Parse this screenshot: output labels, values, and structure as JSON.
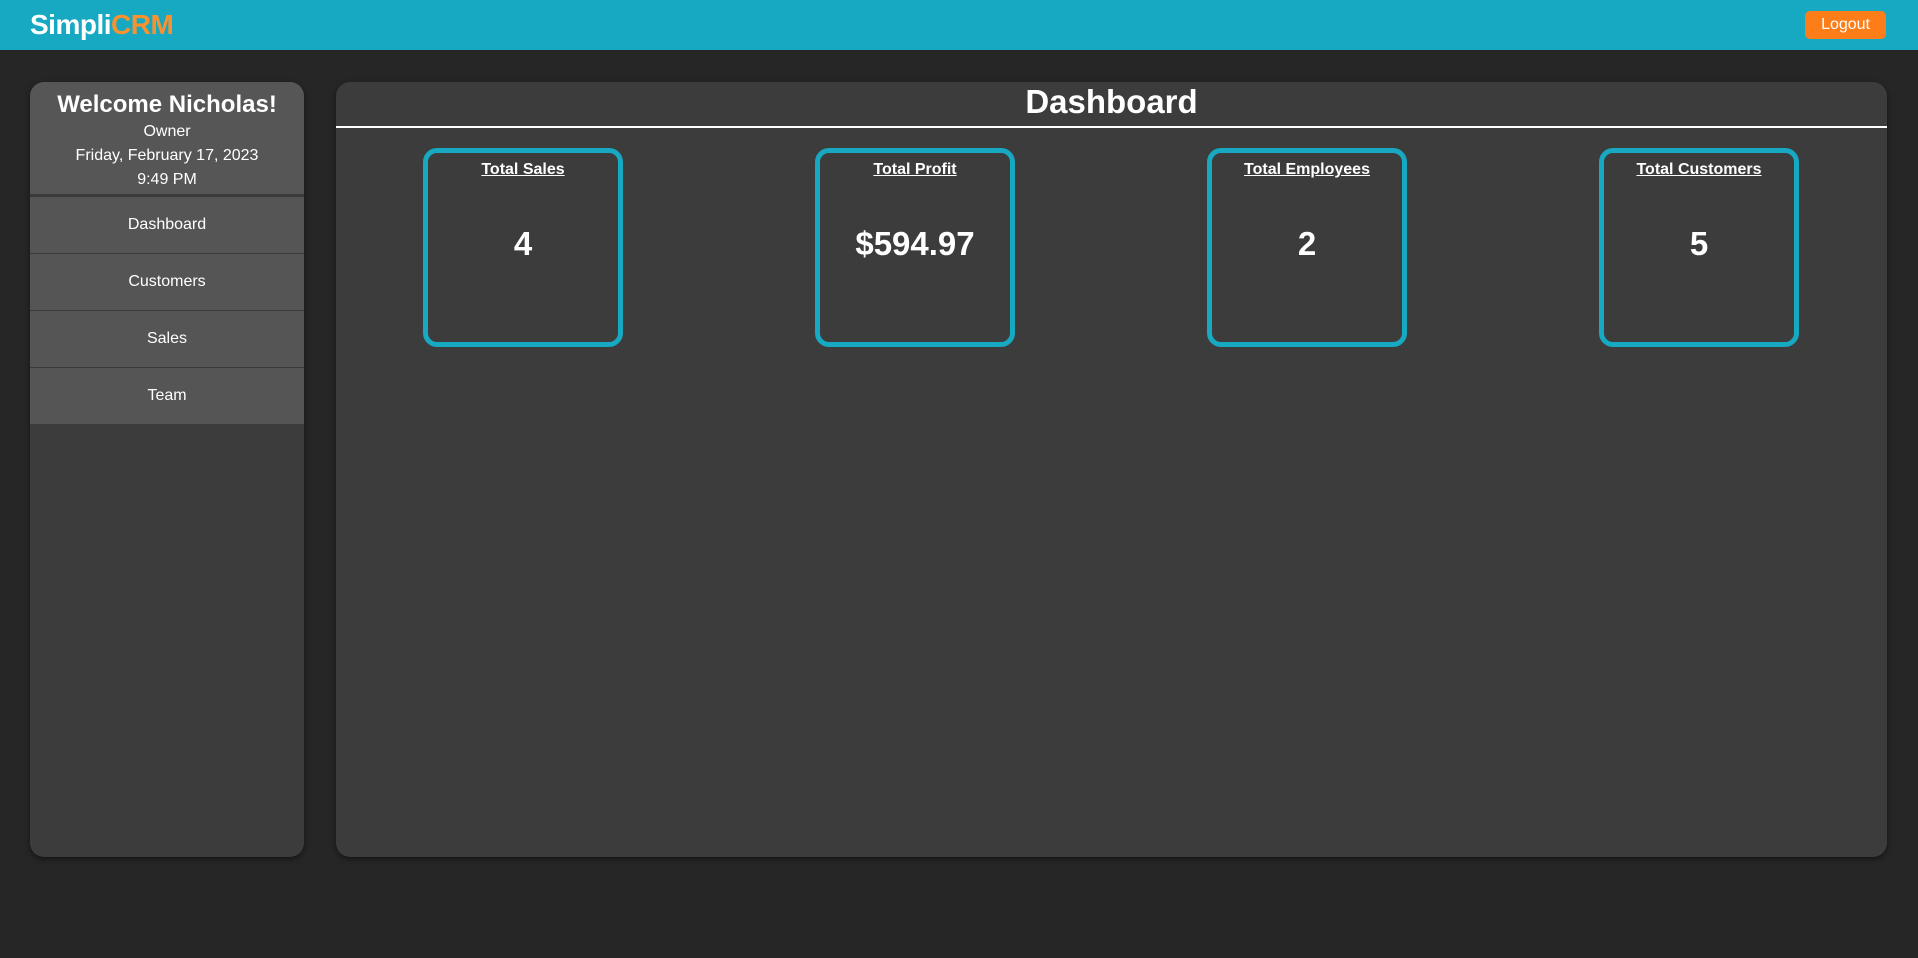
{
  "header": {
    "brand_part1": "Simpli",
    "brand_part2": "CRM",
    "logout_label": "Logout"
  },
  "sidebar": {
    "welcome": "Welcome Nicholas!",
    "role": "Owner",
    "date": "Friday, February 17, 2023",
    "time": "9:49 PM",
    "items": [
      {
        "label": "Dashboard"
      },
      {
        "label": "Customers"
      },
      {
        "label": "Sales"
      },
      {
        "label": "Team"
      }
    ]
  },
  "main": {
    "title": "Dashboard",
    "cards": [
      {
        "label": "Total Sales",
        "value": "4"
      },
      {
        "label": "Total Profit",
        "value": "$594.97"
      },
      {
        "label": "Total Employees",
        "value": "2"
      },
      {
        "label": "Total Customers",
        "value": "5"
      }
    ]
  },
  "colors": {
    "topbar": "#17a9c1",
    "accent_orange": "#f7922e",
    "logout_button": "#fd7d19",
    "card_border": "#17a9c1",
    "page_background": "#262626",
    "panel_background": "#3c3c3c"
  }
}
